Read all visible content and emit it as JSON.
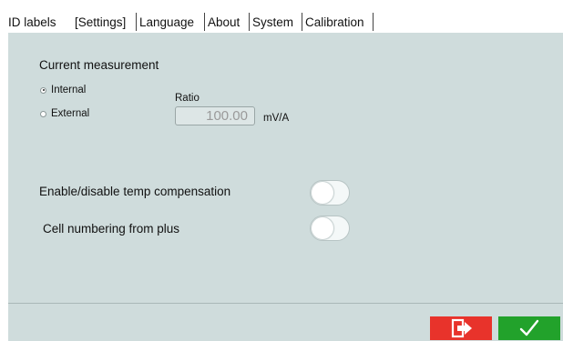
{
  "tabs": [
    {
      "label": "ID labels",
      "active": false
    },
    {
      "label": "[Settings]",
      "active": true
    },
    {
      "label": "Language",
      "active": false
    },
    {
      "label": "About",
      "active": false
    },
    {
      "label": "System",
      "active": false
    },
    {
      "label": "Calibration",
      "active": false
    }
  ],
  "current_measurement": {
    "title": "Current measurement",
    "options": [
      {
        "label": "Internal",
        "selected": true
      },
      {
        "label": "External",
        "selected": false
      }
    ],
    "ratio_label": "Ratio",
    "ratio_value": "100.00",
    "ratio_unit": "mV/A"
  },
  "settings": [
    {
      "label": "Enable/disable temp compensation",
      "enabled": false
    },
    {
      "label": "Cell numbering from plus",
      "enabled": false
    }
  ],
  "footer": {
    "exit_icon": "exit-door-arrow-icon",
    "confirm_icon": "checkmark-icon"
  },
  "colors": {
    "panel_background": "#cfdcdc",
    "exit_button": "#e8332b",
    "confirm_button": "#22a22b"
  }
}
